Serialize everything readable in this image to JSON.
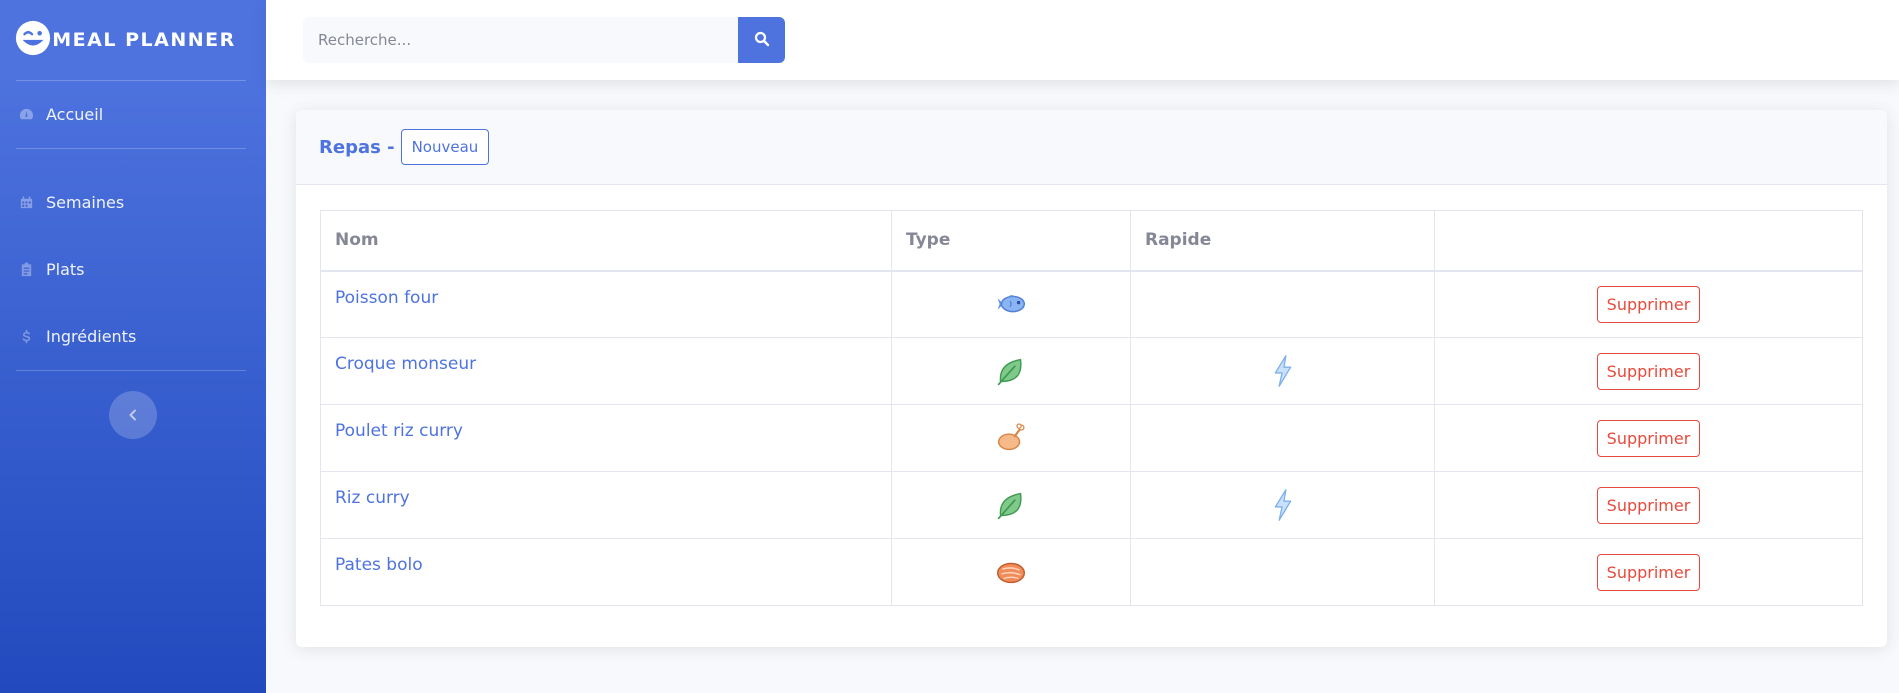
{
  "brand": {
    "title": "MEAL PLANNER",
    "icon": "winking-face-icon"
  },
  "sidebar": {
    "items": [
      {
        "label": "Accueil",
        "icon": "tachometer-icon"
      },
      {
        "label": "Semaines",
        "icon": "calendar-icon"
      },
      {
        "label": "Plats",
        "icon": "clipboard-icon"
      },
      {
        "label": "Ingrédients",
        "icon": "dollar-icon"
      }
    ],
    "toggle_icon": "chevron-left-icon"
  },
  "search": {
    "placeholder": "Recherche...",
    "value": "",
    "icon": "search-icon"
  },
  "card": {
    "title": "Repas -",
    "new_label": "Nouveau"
  },
  "table": {
    "headers": [
      "Nom",
      "Type",
      "Rapide",
      ""
    ],
    "rows": [
      {
        "name": "Poisson four",
        "type_icon": "fish-icon",
        "rapide": false,
        "action": "Supprimer"
      },
      {
        "name": "Croque monseur",
        "type_icon": "leaf-icon",
        "rapide": true,
        "action": "Supprimer"
      },
      {
        "name": "Poulet riz curry",
        "type_icon": "chicken-leg-icon",
        "rapide": false,
        "action": "Supprimer"
      },
      {
        "name": "Riz curry",
        "type_icon": "leaf-icon",
        "rapide": true,
        "action": "Supprimer"
      },
      {
        "name": "Pates bolo",
        "type_icon": "steak-icon",
        "rapide": false,
        "action": "Supprimer"
      }
    ]
  },
  "colors": {
    "primary": "#4e73df",
    "danger": "#e74a3b",
    "text_muted": "#858796",
    "sidebar_gradient_end": "#224abe"
  }
}
